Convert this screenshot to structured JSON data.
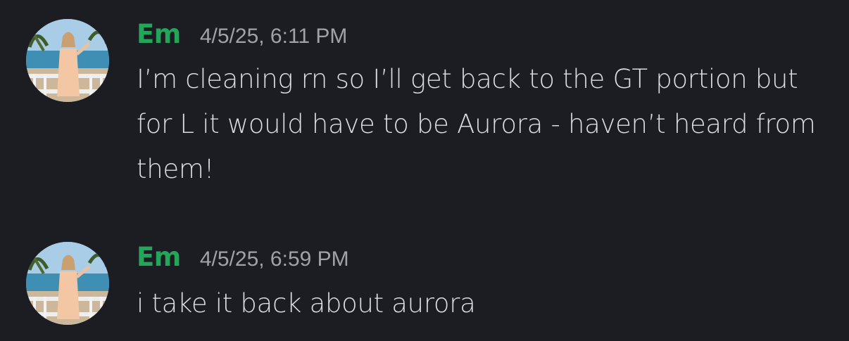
{
  "messages": [
    {
      "author": "Em",
      "timestamp": "4/5/25, 6:11 PM",
      "text": "I’m cleaning rn so I’ll get back to the GT portion but for L it would have to be Aurora - haven’t heard from them!",
      "author_color": "#23a55a"
    },
    {
      "author": "Em",
      "timestamp": "4/5/25, 6:59 PM",
      "text": "i take it back about aurora",
      "author_color": "#23a55a"
    }
  ],
  "colors": {
    "background": "#1c1d22",
    "message_text": "#dcdde1",
    "timestamp_text": "#a0a2aa"
  }
}
